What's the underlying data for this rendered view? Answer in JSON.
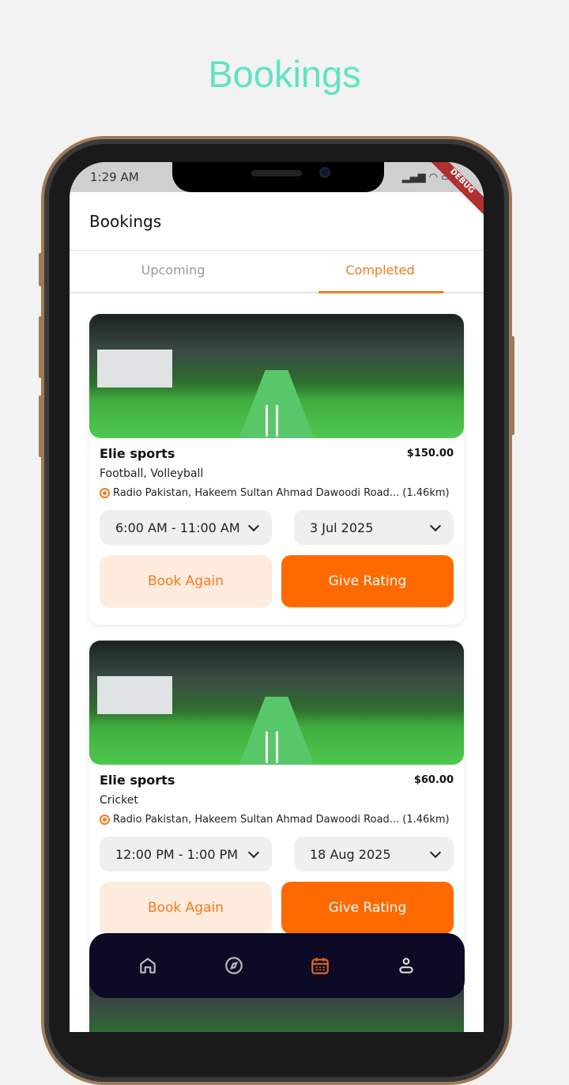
{
  "header": {
    "title": "Bookings"
  },
  "status": {
    "time": "1:29 AM",
    "battery": "81",
    "debug": "DEBUG"
  },
  "appbar": {
    "title": "Bookings"
  },
  "tabs": [
    {
      "label": "Upcoming"
    },
    {
      "label": "Completed"
    }
  ],
  "bookings": [
    {
      "name": "Elie sports",
      "price": "$150.00",
      "sports": "Football, Volleyball",
      "location": "Radio Pakistan, Hakeem Sultan Ahmad Dawoodi Road... (1.46km)",
      "time": "6:00 AM - 11:00 AM",
      "date": "3 Jul 2025",
      "book_again": "Book Again",
      "give_rating": "Give Rating"
    },
    {
      "name": "Elie sports",
      "price": "$60.00",
      "sports": "Cricket",
      "location": "Radio Pakistan, Hakeem Sultan Ahmad Dawoodi Road... (1.46km)",
      "time": "12:00 PM - 1:00 PM",
      "date": "18 Aug 2025",
      "book_again": "Book Again",
      "give_rating": "Give Rating"
    }
  ],
  "nav": [
    {
      "icon": "home-icon"
    },
    {
      "icon": "compass-icon"
    },
    {
      "icon": "calendar-icon",
      "active": true
    },
    {
      "icon": "profile-icon"
    }
  ],
  "colors": {
    "accent": "#ff6a00",
    "nav_bg": "#0c0a24",
    "title": "#5fe3c3"
  }
}
